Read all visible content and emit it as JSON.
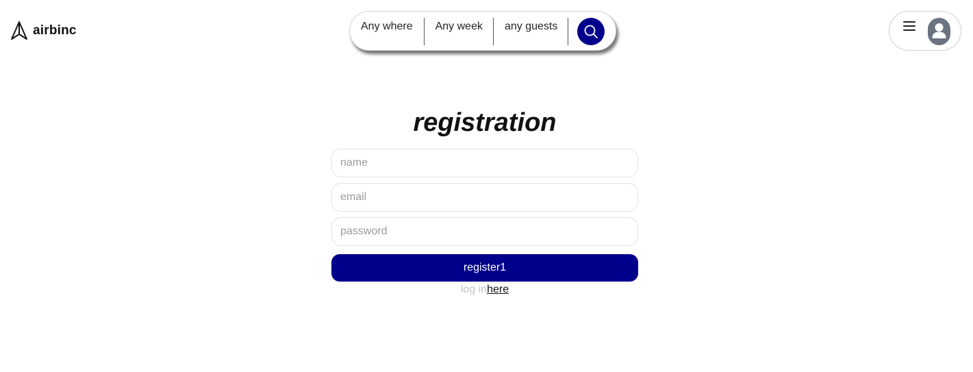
{
  "header": {
    "brand": "airbinc",
    "search": {
      "where": "Any where",
      "week": "Any week",
      "guests": "any guests"
    }
  },
  "form": {
    "title": "registration",
    "name_placeholder": "name",
    "email_placeholder": "email",
    "password_placeholder": "password",
    "submit_label": "register1",
    "login_prefix": "log in",
    "login_link": "here"
  },
  "colors": {
    "accent": "#00008b",
    "avatar": "#6b7280"
  },
  "icons": {
    "logo": "paper-plane-icon",
    "search": "search-icon",
    "menu": "hamburger-icon",
    "user": "user-icon"
  }
}
